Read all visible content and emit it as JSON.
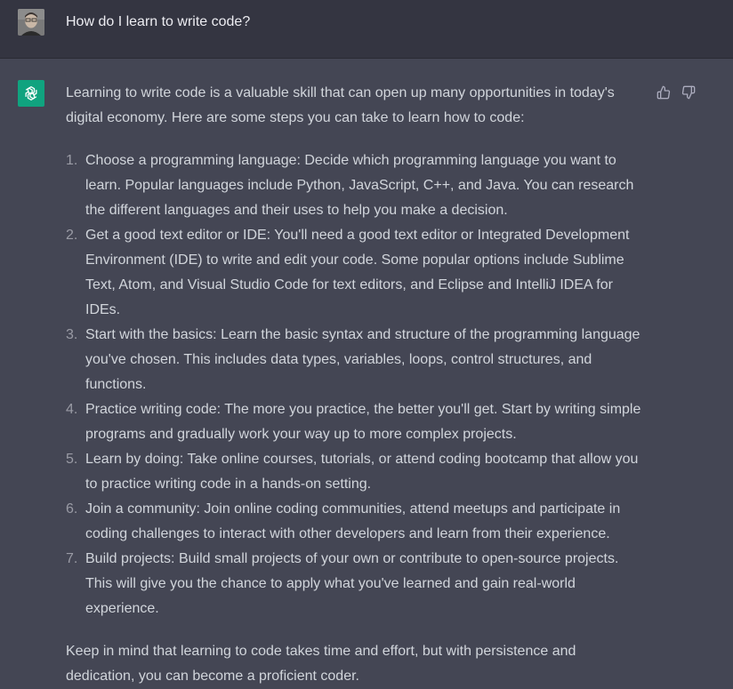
{
  "user_message": {
    "avatar": "user-photo-avatar",
    "text": "How do I learn to write code?"
  },
  "assistant_message": {
    "avatar": "openai-logo-icon",
    "brand_color": "#10a37f",
    "intro": "Learning to write code is a valuable skill that can open up many opportunities in today's digital economy. Here are some steps you can take to learn how to code:",
    "steps": [
      {
        "num": "1.",
        "text": "Choose a programming language: Decide which programming language you want to learn. Popular languages include Python, JavaScript, C++, and Java. You can research the different languages and their uses to help you make a decision."
      },
      {
        "num": "2.",
        "text": "Get a good text editor or IDE: You'll need a good text editor or Integrated Development Environment (IDE) to write and edit your code. Some popular options include Sublime Text, Atom, and Visual Studio Code for text editors, and Eclipse and IntelliJ IDEA for IDEs."
      },
      {
        "num": "3.",
        "text": "Start with the basics: Learn the basic syntax and structure of the programming language you've chosen. This includes data types, variables, loops, control structures, and functions."
      },
      {
        "num": "4.",
        "text": "Practice writing code: The more you practice, the better you'll get. Start by writing simple programs and gradually work your way up to more complex projects."
      },
      {
        "num": "5.",
        "text": "Learn by doing: Take online courses, tutorials, or attend coding bootcamp that allow you to practice writing code in a hands-on setting."
      },
      {
        "num": "6.",
        "text": "Join a community: Join online coding communities, attend meetups and participate in coding challenges to interact with other developers and learn from their experience."
      },
      {
        "num": "7.",
        "text": "Build projects: Build small projects of your own or contribute to open-source projects. This will give you the chance to apply what you've learned and gain real-world experience."
      }
    ],
    "outro": "Keep in mind that learning to code takes time and effort, but with persistence and dedication, you can become a proficient coder."
  },
  "feedback": {
    "thumbs_up_icon": "thumbs-up-icon",
    "thumbs_down_icon": "thumbs-down-icon"
  }
}
